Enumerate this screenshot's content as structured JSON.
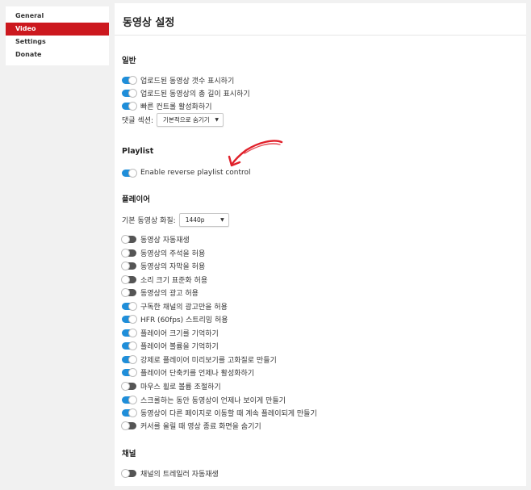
{
  "sidebar": {
    "items": [
      {
        "label": "General",
        "active": false
      },
      {
        "label": "Video",
        "active": true
      },
      {
        "label": "Settings",
        "active": false
      },
      {
        "label": "Donate",
        "active": false
      }
    ]
  },
  "panel": {
    "title": "동영상 설정"
  },
  "sections": {
    "general": {
      "title": "일반",
      "toggles": [
        {
          "label": "업로드된 동영상 갯수 표시하기",
          "on": true
        },
        {
          "label": "업로드된 동영상의 총 길이 표시하기",
          "on": true
        },
        {
          "label": "빠른 컨트롤 활성화하기",
          "on": true
        }
      ],
      "comments_select": {
        "label": "댓글 섹션:",
        "value": "기본적으로 숨기기"
      }
    },
    "playlist": {
      "title": "Playlist",
      "toggles": [
        {
          "label": "Enable reverse playlist control",
          "on": true
        }
      ]
    },
    "player": {
      "title": "플레이어",
      "quality_select": {
        "label": "기본 동영상 화질:",
        "value": "1440p"
      },
      "toggles": [
        {
          "label": "동영상 자동재생",
          "on": false
        },
        {
          "label": "동영상의 주석을 허용",
          "on": false
        },
        {
          "label": "동영상의 자막을 허용",
          "on": false
        },
        {
          "label": "소리 크기 표준화 허용",
          "on": false
        },
        {
          "label": "동영상의 광고 허용",
          "on": false
        },
        {
          "label": "구독한 채널의 광고만을 허용",
          "on": true
        },
        {
          "label": "HFR (60fps) 스트리밍 허용",
          "on": true
        },
        {
          "label": "플레이어 크기를 기억하기",
          "on": true
        },
        {
          "label": "플레이어 볼륨을 기억하기",
          "on": true
        },
        {
          "label": "강제로 플레이어 미리보기를 고화질로 만들기",
          "on": true
        },
        {
          "label": "플레이어 단축키를 언제나 활성화하기",
          "on": true
        },
        {
          "label": "마우스 휠로 볼륨 조절하기",
          "on": false
        },
        {
          "label": "스크롤하는 동안 동영상이 언제나 보이게 만들기",
          "on": true
        },
        {
          "label": "동영상이 다른 페이지로 이동할 때 계속 플레이되게 만들기",
          "on": true
        },
        {
          "label": "커서를 올릴 때 영상 종료 화면을 숨기기",
          "on": false
        }
      ]
    },
    "channel": {
      "title": "채널",
      "toggles": [
        {
          "label": "채널의 트레일러 자동재생",
          "on": false
        }
      ]
    }
  },
  "colors": {
    "accent": "#cc181e",
    "toggle_on": "#1f8ed9",
    "toggle_off": "#555555",
    "annotation": "#e0202a"
  },
  "icons": {
    "select_arrow": "triangle-down-icon",
    "annotation": "red-arrow-icon"
  }
}
